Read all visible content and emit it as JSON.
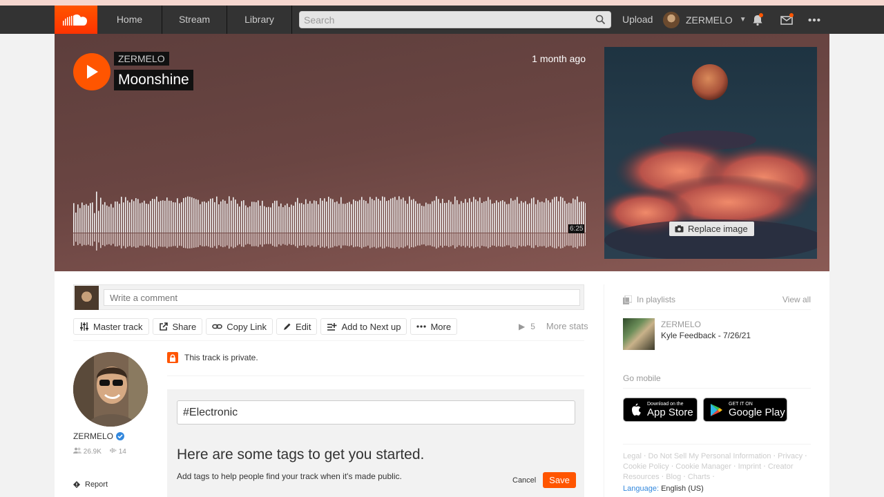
{
  "nav": {
    "home": "Home",
    "stream": "Stream",
    "library": "Library",
    "search_placeholder": "Search",
    "upload": "Upload",
    "username": "ZERMELO"
  },
  "track": {
    "artist": "ZERMELO",
    "title": "Moonshine",
    "age": "1 month ago",
    "duration": "6:25",
    "replace_image": "Replace image"
  },
  "comment": {
    "placeholder": "Write a comment"
  },
  "actions": {
    "master": "Master track",
    "share": "Share",
    "copy": "Copy Link",
    "edit": "Edit",
    "next": "Add to Next up",
    "more": "More",
    "plays": "5",
    "more_stats": "More stats"
  },
  "user": {
    "name": "ZERMELO",
    "followers": "26.9K",
    "tracks": "14",
    "report": "Report"
  },
  "privacy": {
    "text": "This track is private."
  },
  "tags": {
    "value": "#Electronic",
    "heading": "Here are some tags to get you started.",
    "hint": "Add tags to help people find your track when it's made public.",
    "cancel": "Cancel",
    "save": "Save"
  },
  "sidebar": {
    "in_playlists": "In playlists",
    "view_all": "View all",
    "playlist_artist": "ZERMELO",
    "playlist_title": "Kyle Feedback - 7/26/21",
    "go_mobile": "Go mobile",
    "appstore_small": "Download on the",
    "appstore_big": "App Store",
    "google_small": "GET IT ON",
    "google_big": "Google Play",
    "footer": {
      "legal": "Legal",
      "dnsmpi": "Do Not Sell My Personal Information",
      "privacy": "Privacy",
      "cookie_policy": "Cookie Policy",
      "cookie_manager": "Cookie Manager",
      "imprint": "Imprint",
      "creator": "Creator Resources",
      "blog": "Blog",
      "charts": "Charts"
    },
    "language_label": "Language:",
    "language_value": "English (US)"
  },
  "colors": {
    "brand": "#ff5500",
    "nav_bg": "#333333",
    "link_blue": "#3388dd"
  }
}
